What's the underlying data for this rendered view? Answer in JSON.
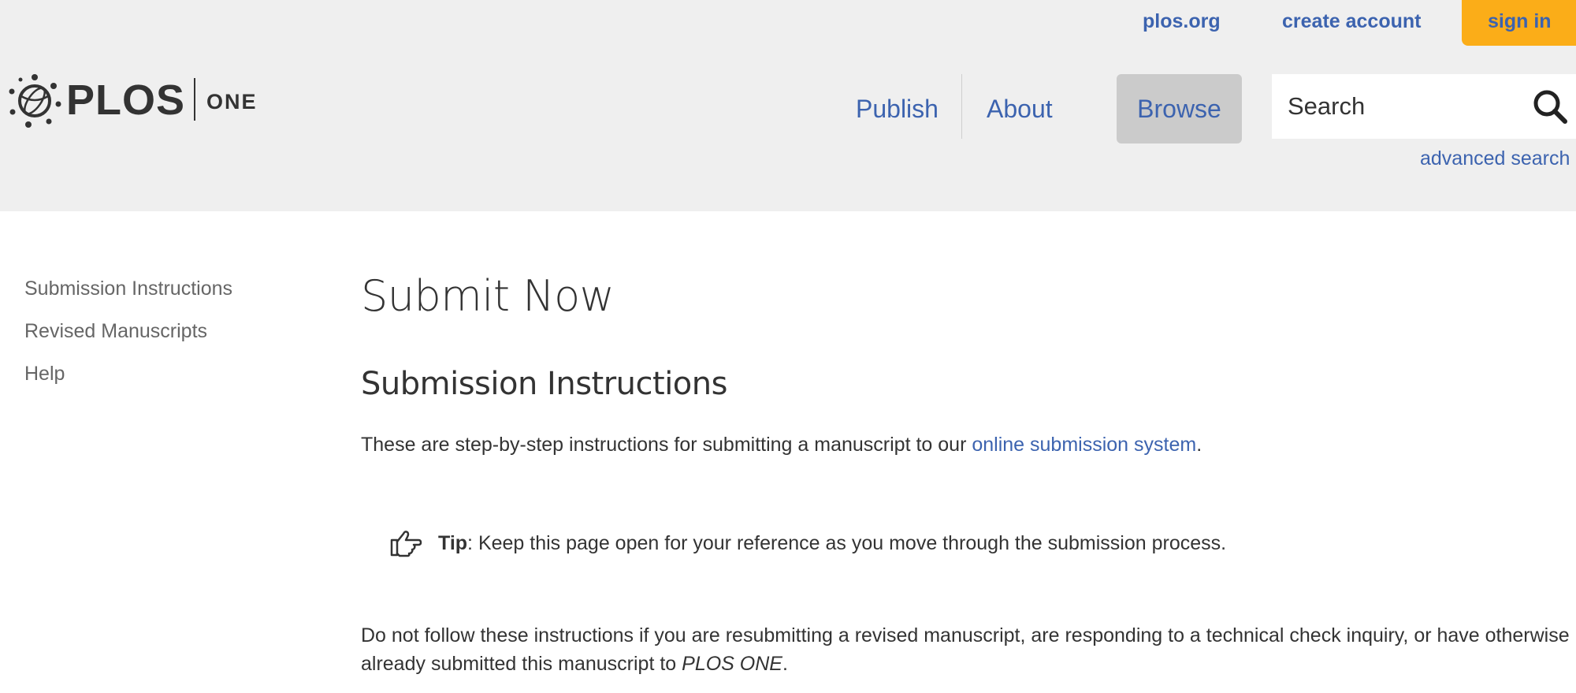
{
  "top_links": {
    "plos_org": "plos.org",
    "create_account": "create account",
    "sign_in": "sign in"
  },
  "logo": {
    "brand": "PLOS",
    "journal": "ONE"
  },
  "nav": {
    "publish": "Publish",
    "about": "About",
    "browse": "Browse",
    "active": "Browse"
  },
  "search": {
    "placeholder": "Search",
    "advanced_link": "advanced search"
  },
  "sidebar": {
    "items": [
      {
        "label": "Submission Instructions"
      },
      {
        "label": "Revised Manuscripts"
      },
      {
        "label": "Help"
      }
    ]
  },
  "main": {
    "title": "Submit Now",
    "section_title": "Submission Instructions",
    "intro_text": "These are step-by-step instructions for submitting a manuscript to our ",
    "intro_link": "online submission system",
    "intro_end": ".",
    "tip_label": "Tip",
    "tip_text": ": Keep this page open for your reference as you move through the submission process.",
    "warning_text": "Do not follow these instructions if you are resubmitting a revised manuscript, are responding to a technical check inquiry, or have otherwise already submitted this manuscript to ",
    "warning_journal": "PLOS ONE",
    "warning_end": "."
  },
  "colors": {
    "header_bg": "#efefef",
    "link_blue": "#3c63af",
    "sign_in_bg": "#fbad18",
    "browse_active_bg": "#cbcbcb"
  }
}
